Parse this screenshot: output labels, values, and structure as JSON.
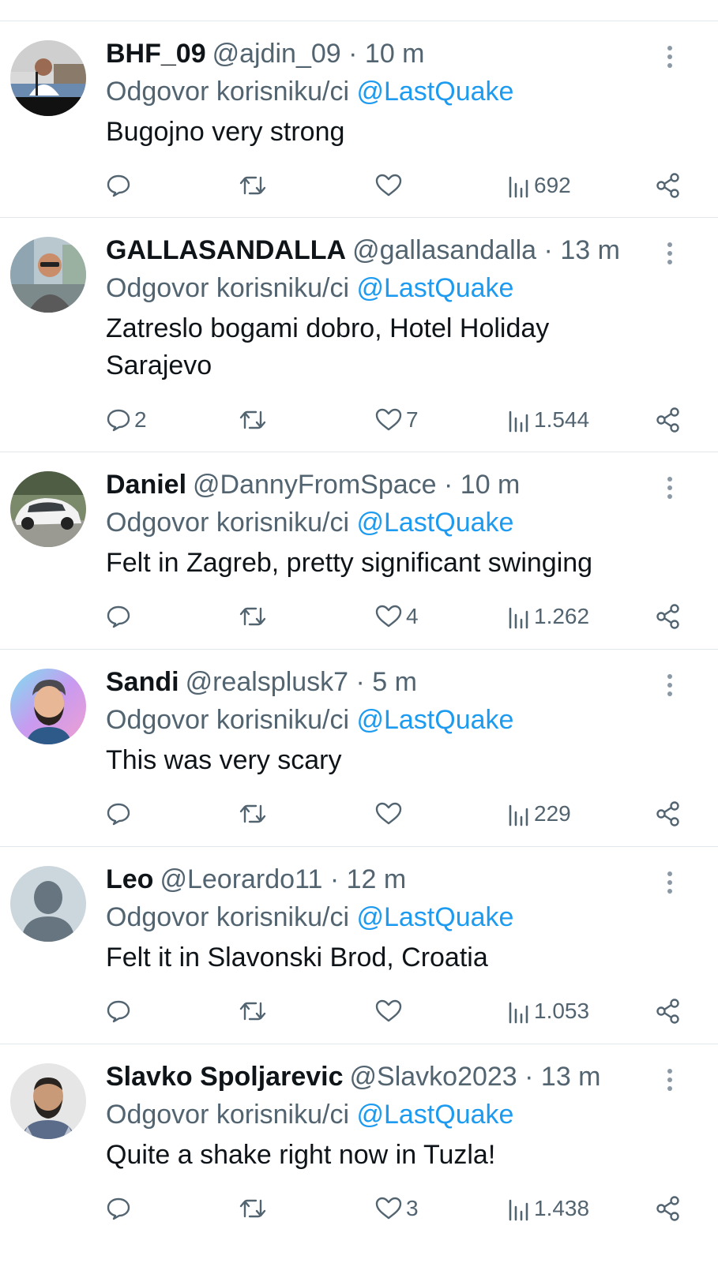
{
  "reply_prefix": "Odgovor korisniku/ci",
  "reply_to": "@LastQuake",
  "colors": {
    "text_primary": "#0f1419",
    "text_secondary": "#536471",
    "accent": "#1d9bf0",
    "divider": "#e1e8ed"
  },
  "icons": {
    "reply": "reply-icon",
    "retweet": "retweet-icon",
    "like": "heart-icon",
    "views": "views-chart-icon",
    "share": "share-icon",
    "more": "more-vertical-icon"
  },
  "tweets": [
    {
      "name": "BHF_09",
      "handle": "@ajdin_09",
      "time": "10 m",
      "text_lines": [
        "Bugojno very strong"
      ],
      "replies": "",
      "likes": "",
      "views": "692",
      "avatar": "man at podium"
    },
    {
      "name": "GALLASANDALLA",
      "handle": "@gallasandalla",
      "time": "13 m",
      "text_lines": [
        "Zatreslo bogami dobro, Hotel Holiday",
        "Sarajevo"
      ],
      "replies": "2",
      "likes": "7",
      "views": "1.544",
      "avatar": "man with sunglasses outdoors"
    },
    {
      "name": "Daniel",
      "handle": "@DannyFromSpace",
      "time": "10 m",
      "text_lines": [
        "Felt in Zagreb, pretty significant swinging"
      ],
      "replies": "",
      "likes": "4",
      "views": "1.262",
      "avatar": "white car"
    },
    {
      "name": "Sandi",
      "handle": "@realsplusk7",
      "time": "5 m",
      "text_lines": [
        "This was very scary"
      ],
      "replies": "",
      "likes": "",
      "views": "229",
      "avatar": "illustrated bearded man"
    },
    {
      "name": "Leo",
      "handle": "@Leorardo11",
      "time": "12 m",
      "text_lines": [
        "Felt it in Slavonski Brod, Croatia"
      ],
      "replies": "",
      "likes": "",
      "views": "1.053",
      "avatar": "default person"
    },
    {
      "name": "Slavko Spoljarevic",
      "handle": "@Slavko2023",
      "time": "13 m",
      "text_lines": [
        "Quite a shake right now in Tuzla!"
      ],
      "replies": "",
      "likes": "3",
      "views": "1.438",
      "avatar": "bearded man"
    }
  ]
}
